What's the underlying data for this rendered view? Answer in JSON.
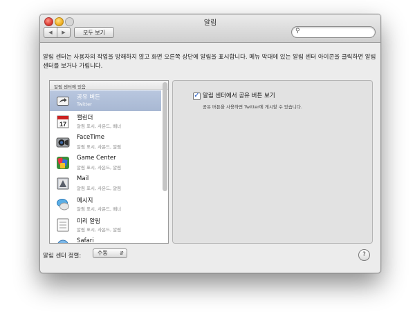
{
  "window": {
    "title": "알림"
  },
  "toolbar": {
    "back": "◀",
    "forward": "▶",
    "show_all": "모두 보기",
    "search_value": "",
    "search_icon": "search-icon"
  },
  "description": "알림 센터는 사용자의 작업을 방해하지 않고 화면 오른쪽 상단에 알림을 표시합니다. 메뉴 막대에 있는 알림 센터 아이콘을 클릭하면 알림 센터를 보거나 가립니다.",
  "list": {
    "header": "알림 센터에 있음",
    "items": [
      {
        "name": "공유 버튼",
        "sub": "Twitter",
        "icon": "share-icon",
        "selected": true
      },
      {
        "name": "캘린더",
        "sub": "알림 표시, 사운드, 배너",
        "icon": "calendar-icon",
        "icon_text": "17",
        "selected": false
      },
      {
        "name": "FaceTime",
        "sub": "알림 표시, 사운드, 알림",
        "icon": "facetime-icon",
        "selected": false
      },
      {
        "name": "Game Center",
        "sub": "알림 표시, 사운드, 알림",
        "icon": "game-center-icon",
        "selected": false
      },
      {
        "name": "Mail",
        "sub": "알림 표시, 사운드, 알림",
        "icon": "mail-icon",
        "selected": false
      },
      {
        "name": "메시지",
        "sub": "알림 표시, 사운드, 배너",
        "icon": "messages-icon",
        "selected": false
      },
      {
        "name": "미리 알림",
        "sub": "알림 표시, 사운드, 알림",
        "icon": "reminders-icon",
        "selected": false
      },
      {
        "name": "Safari",
        "sub": "",
        "icon": "safari-icon",
        "selected": false
      }
    ]
  },
  "detail": {
    "checkbox_label": "알림 센터에서 공유 버튼 보기",
    "checked": true,
    "checkbox_mark": "✓",
    "description": "공유 버튼을 사용하면 Twitter에 게시할 수 있습니다."
  },
  "footer": {
    "sort_label": "알림 센터 정렬:",
    "sort_value": "수동",
    "help": "?"
  }
}
